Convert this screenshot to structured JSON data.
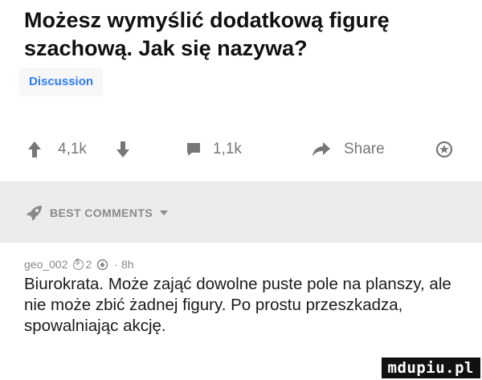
{
  "post": {
    "title": "Możesz wymyślić dodatkową figurę szachową. Jak się nazywa?",
    "tag": "Discussion"
  },
  "actions": {
    "upvotes": "4,1k",
    "comments": "1,1k",
    "share": "Share"
  },
  "best_comments": {
    "label": "BEST COMMENTS"
  },
  "comment": {
    "username": "geo_002",
    "coins": "2",
    "time": "8h",
    "text": "Biurokrata. Może zająć dowolne puste pole na planszy, ale nie może zbić żadnej figury. Po prostu przeszkadza, spowalniając akcję."
  },
  "watermark": "mdupiu.pl",
  "colors": {
    "accent_blue": "#2f7cf6",
    "icon_gray": "#777777",
    "banner_bg": "#ececec"
  }
}
